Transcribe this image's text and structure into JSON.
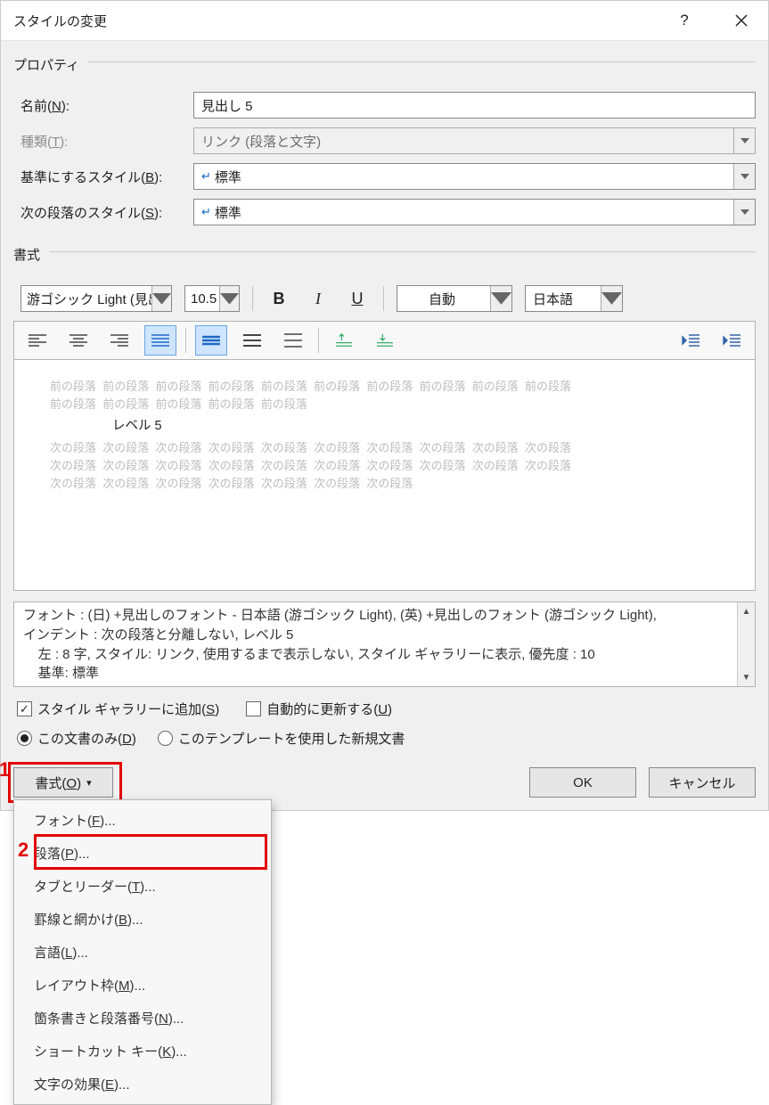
{
  "title": "スタイルの変更",
  "helpGlyph": "?",
  "properties": {
    "heading": "プロパティ",
    "nameLabel": "名前(N):",
    "nameValue": "見出し 5",
    "typeLabel": "種類(T):",
    "typeValue": "リンク (段落と文字)",
    "baseLabel": "基準にするスタイル(B):",
    "baseValue": "標準",
    "nextLabel": "次の段落のスタイル(S):",
    "nextValue": "標準"
  },
  "format": {
    "heading": "書式",
    "fontName": "游ゴシック Light (見出",
    "fontSize": "10.5",
    "bold": "B",
    "italic": "I",
    "underline": "U",
    "autoColor": "自動",
    "lang": "日本語"
  },
  "preview": {
    "prevPara": "前の段落  前の段落  前の段落  前の段落  前の段落  前の段落  前の段落  前の段落  前の段落  前の段落",
    "prevPara2": "前の段落  前の段落  前の段落  前の段落  前の段落",
    "sample": "レベル 5",
    "nextPara": "次の段落  次の段落  次の段落  次の段落  次の段落  次の段落  次の段落  次の段落  次の段落  次の段落",
    "nextPara2": "次の段落  次の段落  次の段落  次の段落  次の段落  次の段落  次の段落  次の段落  次の段落  次の段落",
    "nextPara3": "次の段落  次の段落  次の段落  次の段落  次の段落  次の段落  次の段落"
  },
  "desc": {
    "line1": "フォント : (日) +見出しのフォント - 日本語 (游ゴシック Light), (英) +見出しのフォント (游ゴシック Light),",
    "line2": "インデント : 次の段落と分離しない, レベル 5",
    "line3": "    左 :  8 字, スタイル: リンク, 使用するまで表示しない, スタイル ギャラリーに表示, 優先度 : 10",
    "line4": "    基準: 標準"
  },
  "checks": {
    "addGallery": "スタイル ギャラリーに追加(S)",
    "autoUpdate": "自動的に更新する(U)"
  },
  "radios": {
    "thisDoc": "この文書のみ(D)",
    "template": "このテンプレートを使用した新規文書"
  },
  "formatButton": "書式(O)",
  "ok": "OK",
  "cancel": "キャンセル",
  "menu": {
    "font": "フォント(F)...",
    "para": "段落(P)...",
    "tabs": "タブとリーダー(T)...",
    "border": "罫線と網かけ(B)...",
    "lang": "言語(L)...",
    "frame": "レイアウト枠(M)...",
    "bullets": "箇条書きと段落番号(N)...",
    "shortcut": "ショートカット キー(K)...",
    "textfx": "文字の効果(E)..."
  },
  "annot": {
    "one": "1",
    "two": "2"
  }
}
